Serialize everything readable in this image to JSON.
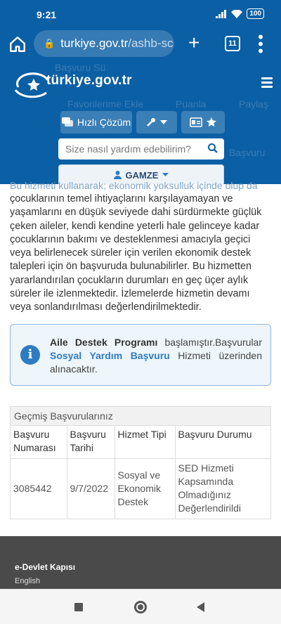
{
  "status_bar": {
    "time": "9:21",
    "battery": "100"
  },
  "browser": {
    "url_host": "turkiye.gov.tr",
    "url_path": "/ashb-sc",
    "tab_count": "11"
  },
  "header": {
    "logo_text": "türkiye.gov.tr",
    "ghost_breadcrumb": "Başvuru Sü",
    "ghost_favorites": "Favorilerime Ekle",
    "ghost_rate": "Puanla",
    "ghost_share": "Paylaş",
    "ghost_apply": "Başvuru",
    "quick_solution_label": "Hızlı Çözüm",
    "search_placeholder": "Size nasıl yardım edebilirim?",
    "user_name": "GAMZE"
  },
  "main": {
    "ghost_intro": "Bu hizmeti kullanarak; ekonomik yoksulluk içinde olup da",
    "paragraph": "çocuklarının temel ihtiyaçlarını karşılayamayan ve yaşamlarını en düşük seviyede dahi sürdürmekte güçlük çeken aileler, kendi kendine yeterli hale gelinceye kadar çocuklarının bakımı ve desteklenmesi amacıyla geçici veya belirlenecek süreler için verilen ekonomik destek talepleri için ön başvuruda bulunabilirler. Bu hizmetten yararlandırılan çocukların durumları en geç üçer aylık süreler ile izlenmektedir. İzlemelerde hizmetin devamı veya sonlandırılması değerlendirilmektedir."
  },
  "info": {
    "program_name": "Aile Destek Programı",
    "text_after_program": " başlamıştır.Başvurular ",
    "link_text": "Sosyal Yardım Başvuru",
    "text_after_link": " Hizmeti üzerinden alınacaktır."
  },
  "history": {
    "title": "Geçmiş Başvurularınız",
    "columns": [
      "Başvuru Numarası",
      "Başvuru Tarihi",
      "Hizmet Tipi",
      "Başvuru Durumu"
    ],
    "rows": [
      {
        "number": "3085442",
        "date": "9/7/2022",
        "service_type": "Sosyal ve Ekonomik Destek",
        "status": "SED Hizmeti Kapsamında Olmadığınız Değerlendirildi"
      }
    ]
  },
  "footer": {
    "title": "e-Devlet Kapısı",
    "language_link": "English"
  },
  "colors": {
    "brand_blue": "#0b5fa5",
    "info_blue": "#2d7cc2",
    "footer_gray": "#4a4a4a"
  },
  "icons": [
    "home-icon",
    "lock-icon",
    "plus-icon",
    "tabs-icon",
    "menu-dots-icon",
    "hamburger-icon",
    "chat-icon",
    "wrench-icon",
    "id-card-icon",
    "star-icon",
    "search-icon",
    "user-icon",
    "caret-down-icon",
    "info-icon"
  ]
}
